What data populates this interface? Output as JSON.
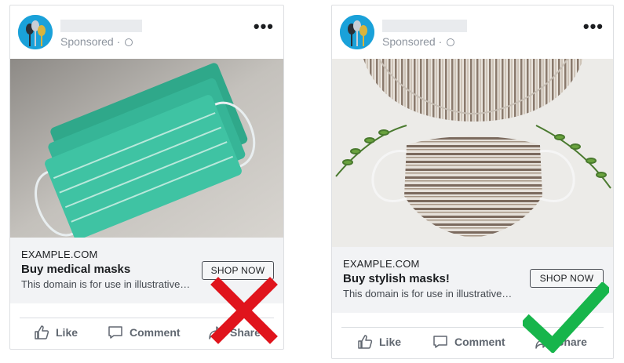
{
  "colors": {
    "cross": "#e0141c",
    "check": "#17b54b",
    "link_box_bg": "#f2f3f5",
    "avatar_bg": "#1aa1d9"
  },
  "left_ad": {
    "sponsored": "Sponsored ·",
    "more_icon": "more-dots-icon",
    "domain": "EXAMPLE.COM",
    "headline": "Buy medical masks",
    "description": "This domain is for use in illustrative…",
    "cta": "SHOP NOW",
    "actions": {
      "like": "Like",
      "comment": "Comment",
      "share": "Share"
    },
    "verdict_icon": "red-x-icon"
  },
  "right_ad": {
    "sponsored": "Sponsored ·",
    "more_icon": "more-dots-icon",
    "domain": "EXAMPLE.COM",
    "headline": "Buy stylish masks!",
    "description": "This domain is for use in illustrative…",
    "cta": "SHOP NOW",
    "actions": {
      "like": "Like",
      "comment": "Comment",
      "share": "Share"
    },
    "verdict_icon": "green-check-icon"
  }
}
